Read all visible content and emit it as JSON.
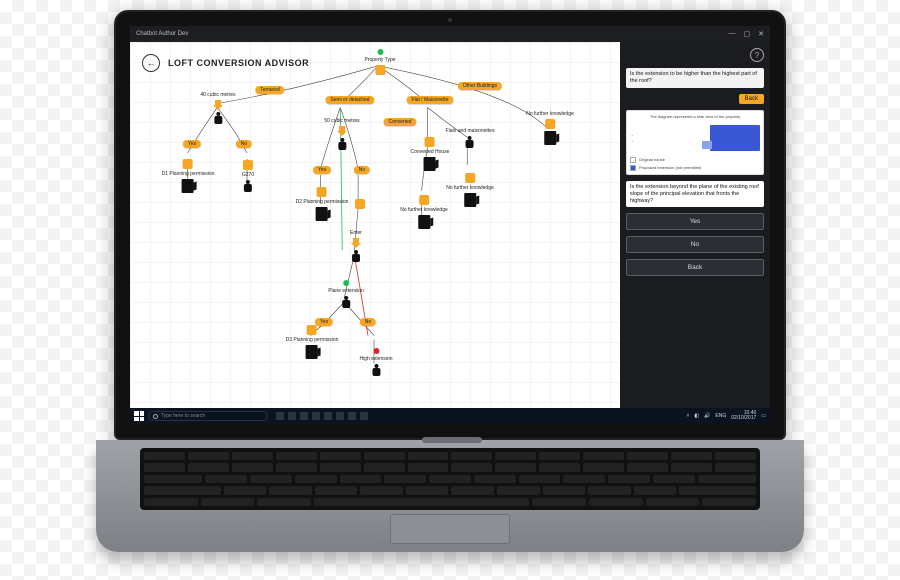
{
  "window": {
    "title": "Chatbot Author Dev",
    "min": "—",
    "max": "▢",
    "close": "✕"
  },
  "canvas": {
    "back": "←",
    "title": "LOFT CONVERSION ADVISOR",
    "root": "Property Type",
    "branch": {
      "terraced": "Terraced",
      "semi": "Semi or detached",
      "flat": "Flat / Maisonette",
      "other": "Other Buildings"
    },
    "n": {
      "cubic40": "40 cubic metres",
      "cubic50": "50 cubic metres",
      "converted": "Converted",
      "conv_house": "Converted House",
      "flats_m": "Flats and maisonettes",
      "nf1": "No further knowledge",
      "nf2": "No further knowledge",
      "nf3": "No further knowledge",
      "d1": "D1 Planning permission",
      "d2": "D2 Planning permission",
      "d3": "D3 Planning permission",
      "g270": "G270",
      "enter": "Enter",
      "plane": "Plane extension",
      "high": "High extension"
    },
    "yn": {
      "yes": "Yes",
      "no": "No"
    }
  },
  "chat": {
    "help": "?",
    "prev": "Is the extension to be higher than the highest part of the roof?",
    "back": "Back",
    "thumb_caption": "The diagram represents a side view of the property",
    "legend": {
      "a": "Original house",
      "b": "Proposed extension (not permitted)"
    },
    "question": "Is the extension beyond the plane of the existing roof slope of the principal elevation that fronts the highway?",
    "answers": {
      "yes": "Yes",
      "no": "No",
      "back": "Back"
    }
  },
  "taskbar": {
    "search_placeholder": "Type here to search",
    "lang": "ENG",
    "time": "10:40",
    "date": "02/10/2017"
  }
}
